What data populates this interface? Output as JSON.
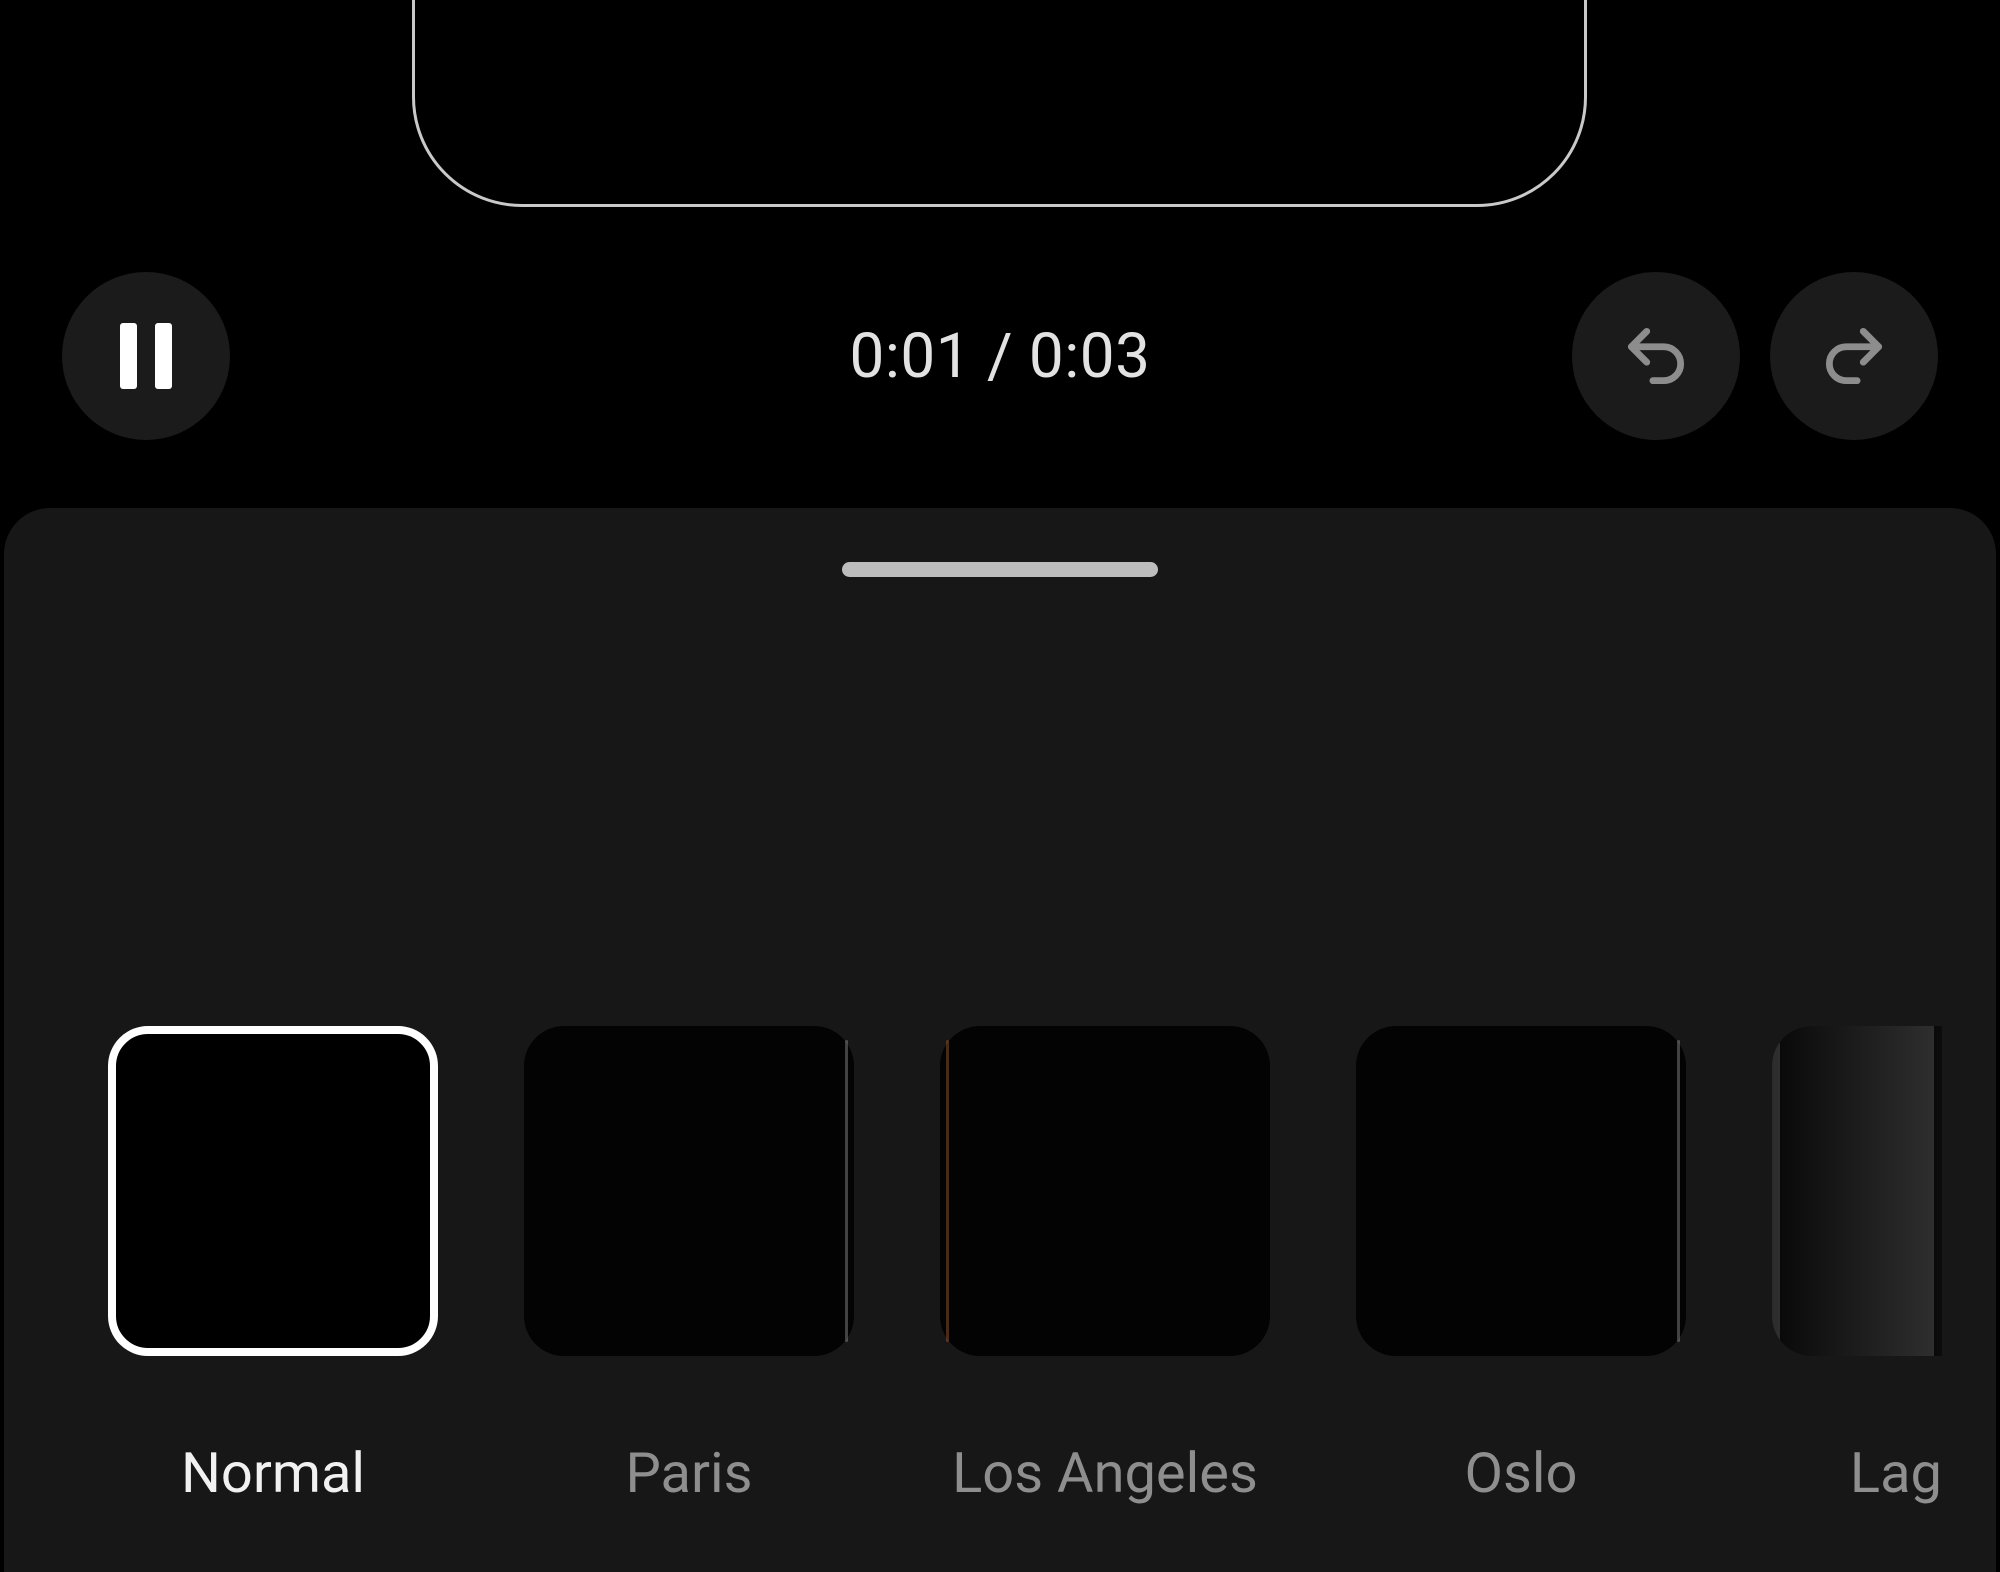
{
  "playback": {
    "time_display": "0:01 / 0:03"
  },
  "filters": [
    {
      "label": "Normal",
      "selected": true
    },
    {
      "label": "Paris",
      "selected": false
    },
    {
      "label": "Los Angeles",
      "selected": false
    },
    {
      "label": "Oslo",
      "selected": false
    },
    {
      "label": "Lag",
      "selected": false,
      "partial": true
    }
  ]
}
